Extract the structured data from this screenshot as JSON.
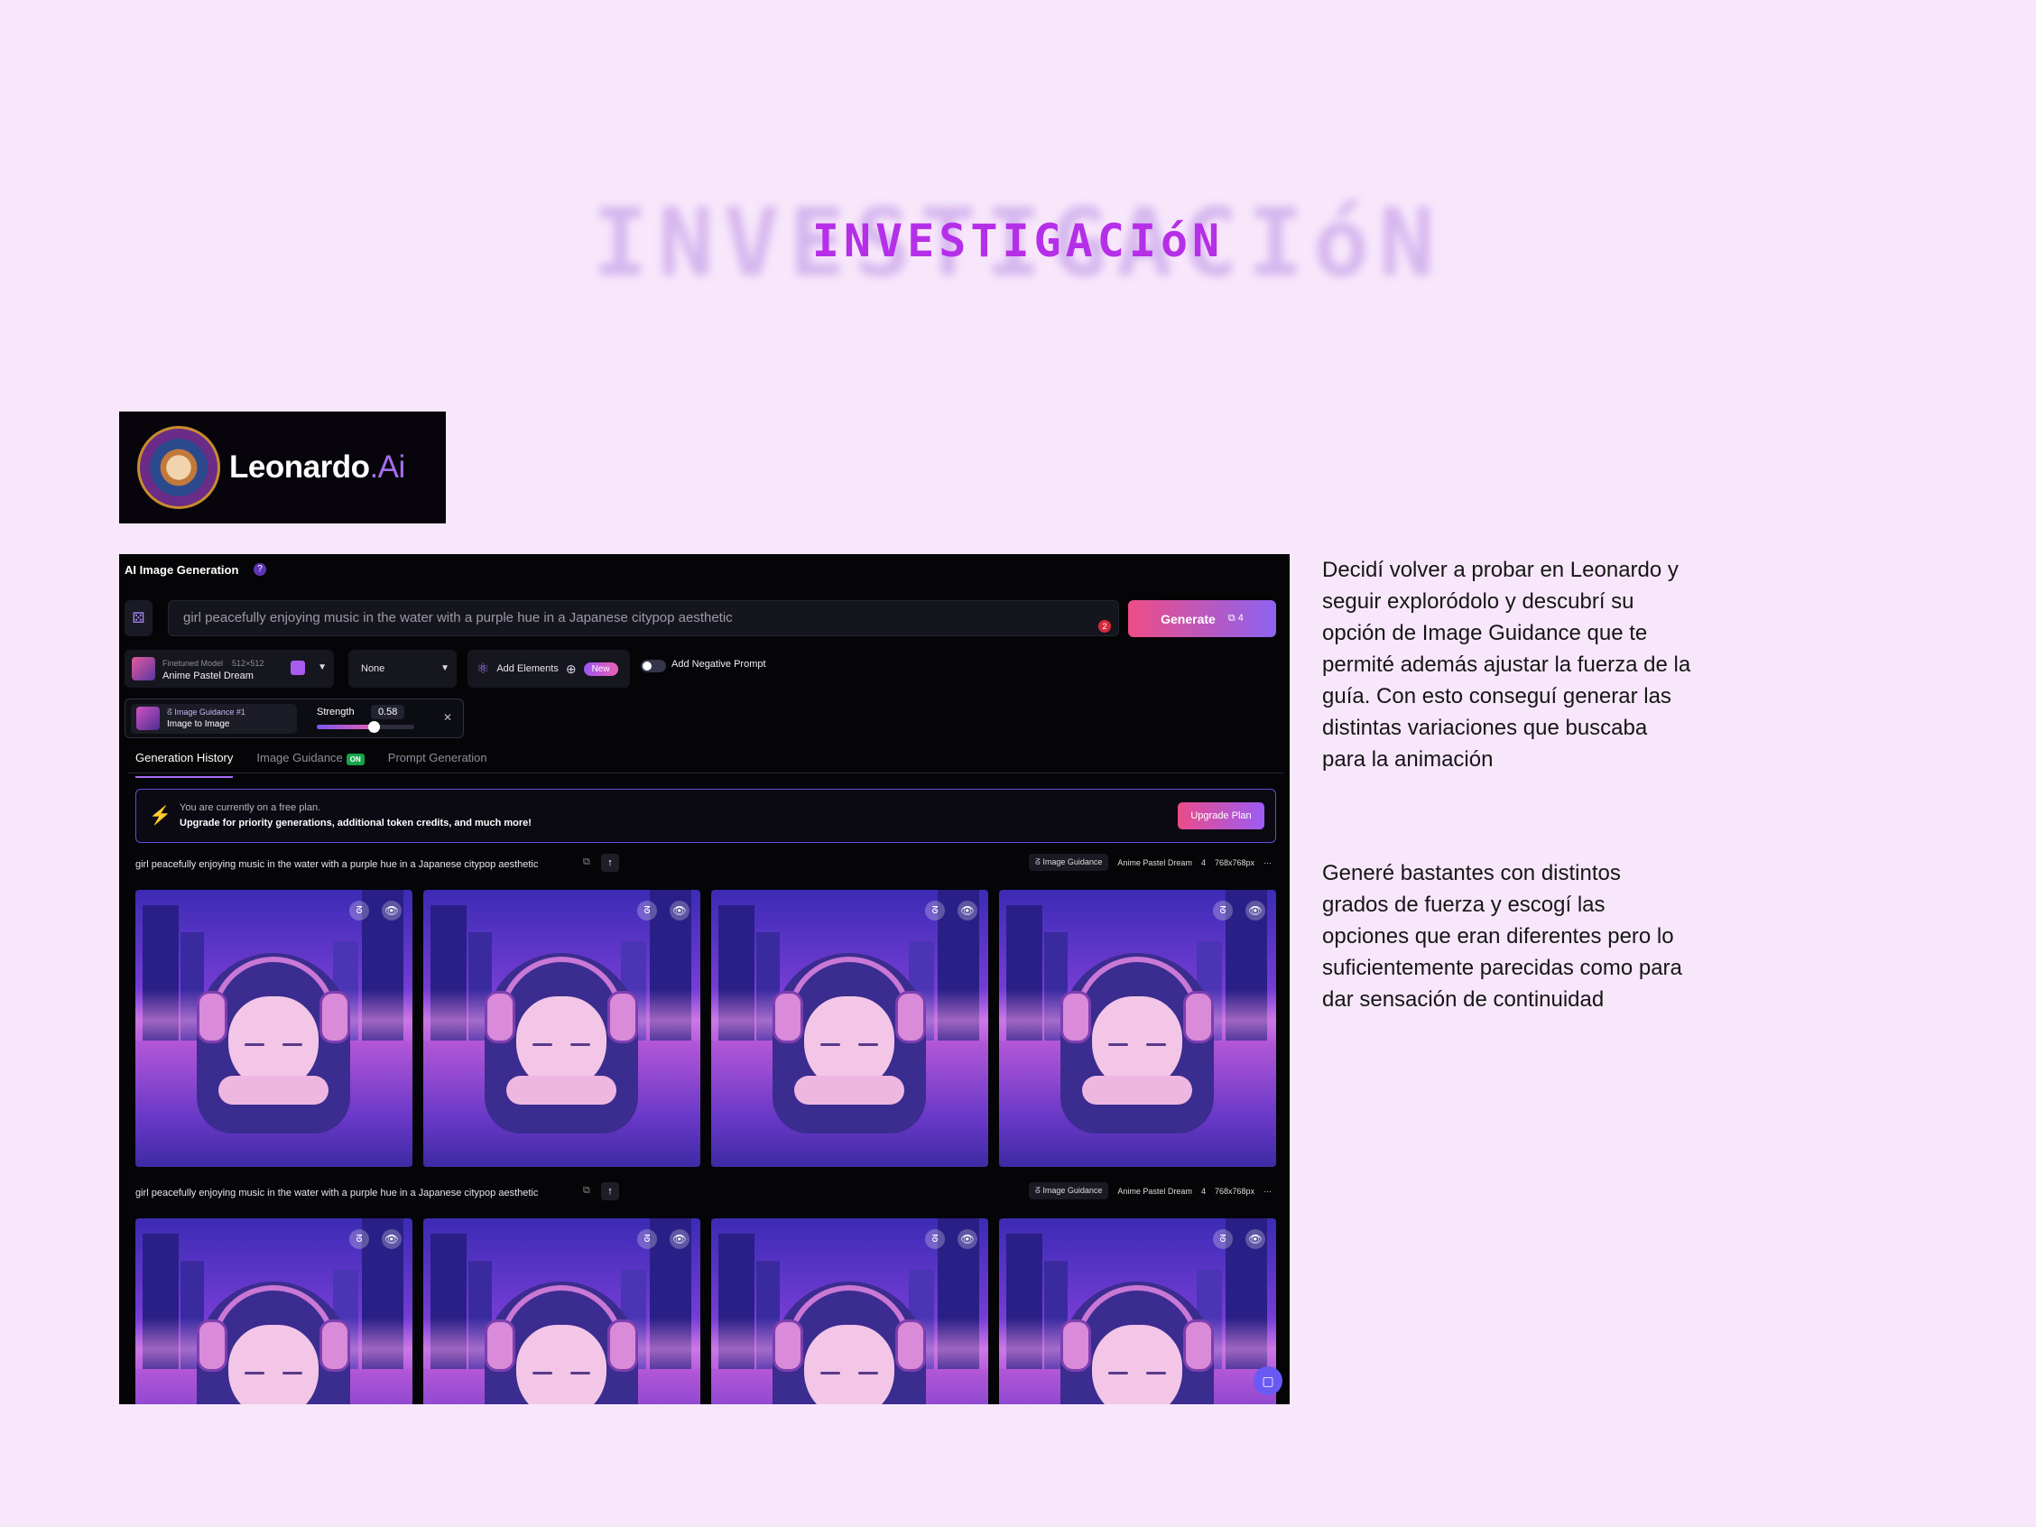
{
  "title": "INVESTIGACIóN",
  "logo": {
    "name": "Leonardo",
    "dot_ai": ".Ai"
  },
  "app": {
    "section_title": "AI Image Generation",
    "help_icon": "?",
    "prompt": "girl peacefully enjoying music in the water with a purple hue in a Japanese citypop aesthetic",
    "prompt_badge": "2",
    "generate_label": "Generate",
    "generate_cost": "⧉ 4",
    "model": {
      "label": "Finetuned Model",
      "size": "512×512",
      "name": "Anime Pastel Dream"
    },
    "style_select": "None",
    "add_elements": "Add Elements",
    "new_badge": "New",
    "negative_prompt": "Add Negative Prompt",
    "guidance": {
      "label": "Image Guidance #1",
      "mode": "Image to Image",
      "strength_label": "Strength",
      "strength_value": "0.58",
      "strength": 0.58
    },
    "tabs": [
      {
        "label": "Generation History"
      },
      {
        "label": "Image Guidance",
        "badge": "ON"
      },
      {
        "label": "Prompt Generation"
      }
    ],
    "banner": {
      "line1": "You are currently on a free plan.",
      "line2": "Upgrade for priority generations, additional token credits, and much more!",
      "button": "Upgrade Plan"
    },
    "batches": [
      {
        "prompt": "girl peacefully enjoying music in the water with a purple hue in a Japanese citypop aesthetic",
        "guidance": "Image Guidance",
        "model": "Anime Pastel Dream",
        "count": "4",
        "size": "768x768px",
        "more": "···"
      },
      {
        "prompt": "girl peacefully enjoying music in the water with a purple hue in a Japanese citypop aesthetic",
        "guidance": "Image Guidance",
        "model": "Anime Pastel Dream",
        "count": "4",
        "size": "768x768px",
        "more": "···"
      }
    ]
  },
  "side_text": {
    "p1": "Decidí volver a probar en Leonardo y seguir exploródolo y descubrí su opción de Image Guidance que te permité además ajustar la fuerza de la guía. Con esto conseguí generar las distintas variaciones que buscaba para la animación",
    "p2": "Generé bastantes con distintos grados de fuerza y escogí las opciones que eran diferentes pero lo suficientemente parecidas como para dar sensación de continuidad"
  },
  "icons": [
    "dice-icon",
    "atom-icon",
    "bolt-icon",
    "eye-icon",
    "guidance-icon",
    "chat-icon"
  ],
  "colors": {
    "background": "#f8e7fb",
    "title": "#b52fe8",
    "accent": "#8c63f1",
    "generate_start": "#ee4c86"
  }
}
